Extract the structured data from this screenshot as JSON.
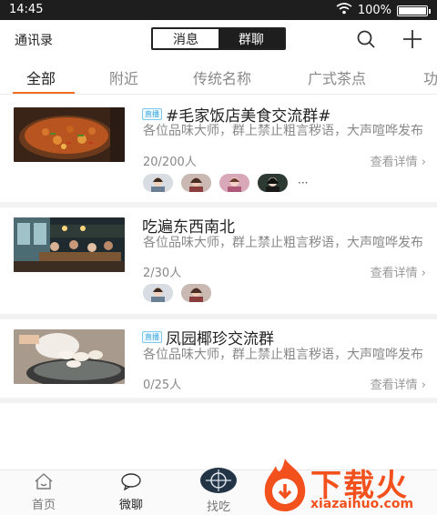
{
  "status_bar": {
    "time": "14:45",
    "battery": "100%",
    "battery_level": 1.0
  },
  "header": {
    "contacts_label": "通讯录",
    "segments": [
      {
        "label": "消息",
        "active": false
      },
      {
        "label": "群聊",
        "active": true
      }
    ],
    "search_icon": "search-icon",
    "add_icon": "plus-icon"
  },
  "tabs": [
    {
      "label": "全部",
      "active": true
    },
    {
      "label": "附近",
      "active": false
    },
    {
      "label": "传统名称",
      "active": false
    },
    {
      "label": "广式茶点",
      "active": false
    },
    {
      "label": "功",
      "active": false
    }
  ],
  "groups": [
    {
      "live_badge": "直播",
      "title": "#毛家饭店美食交流群#",
      "description": "各位品味大师，群上禁止粗言秽语，大声喧哗发布",
      "count": "20/200人",
      "detail_label": "查看详情",
      "member_avatars": 4,
      "more": "···"
    },
    {
      "live_badge": "",
      "title": "吃遍东西南北",
      "description": "各位品味大师，群上禁止粗言秽语，大声喧哗发布",
      "count": "2/30人",
      "detail_label": "查看详情",
      "member_avatars": 2,
      "more": ""
    },
    {
      "live_badge": "直播",
      "title": "凤园椰珍交流群",
      "description": "各位品味大师，群上禁止粗言秽语，大声喧哗发布",
      "count": "0/25人",
      "detail_label": "查看详情",
      "member_avatars": 0,
      "more": ""
    }
  ],
  "bottom_nav": [
    {
      "label": "首页",
      "icon": "home-icon",
      "active": false
    },
    {
      "label": "微聊",
      "icon": "chat-icon",
      "active": true
    },
    {
      "label": "找吃",
      "icon": "crosshair-icon",
      "active": false
    }
  ],
  "watermark": {
    "brand": "下载火",
    "url": "xiazaihuo.com"
  },
  "colors": {
    "accent": "#f26d21",
    "dark": "#1e1e1e",
    "badge": "#3aa7e0"
  }
}
